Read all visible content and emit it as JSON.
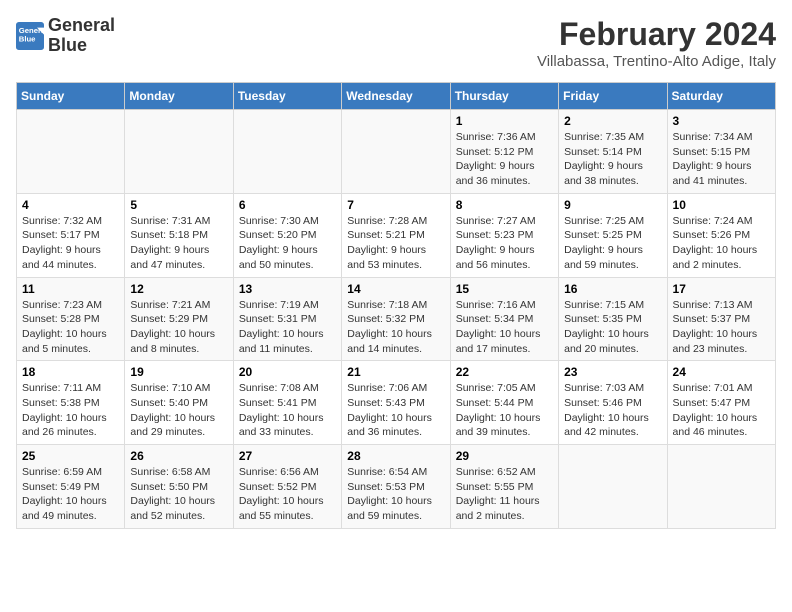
{
  "header": {
    "logo_line1": "General",
    "logo_line2": "Blue",
    "title": "February 2024",
    "subtitle": "Villabassa, Trentino-Alto Adige, Italy"
  },
  "days_of_week": [
    "Sunday",
    "Monday",
    "Tuesday",
    "Wednesday",
    "Thursday",
    "Friday",
    "Saturday"
  ],
  "weeks": [
    [
      {
        "day": "",
        "info": ""
      },
      {
        "day": "",
        "info": ""
      },
      {
        "day": "",
        "info": ""
      },
      {
        "day": "",
        "info": ""
      },
      {
        "day": "1",
        "info": "Sunrise: 7:36 AM\nSunset: 5:12 PM\nDaylight: 9 hours\nand 36 minutes."
      },
      {
        "day": "2",
        "info": "Sunrise: 7:35 AM\nSunset: 5:14 PM\nDaylight: 9 hours\nand 38 minutes."
      },
      {
        "day": "3",
        "info": "Sunrise: 7:34 AM\nSunset: 5:15 PM\nDaylight: 9 hours\nand 41 minutes."
      }
    ],
    [
      {
        "day": "4",
        "info": "Sunrise: 7:32 AM\nSunset: 5:17 PM\nDaylight: 9 hours\nand 44 minutes."
      },
      {
        "day": "5",
        "info": "Sunrise: 7:31 AM\nSunset: 5:18 PM\nDaylight: 9 hours\nand 47 minutes."
      },
      {
        "day": "6",
        "info": "Sunrise: 7:30 AM\nSunset: 5:20 PM\nDaylight: 9 hours\nand 50 minutes."
      },
      {
        "day": "7",
        "info": "Sunrise: 7:28 AM\nSunset: 5:21 PM\nDaylight: 9 hours\nand 53 minutes."
      },
      {
        "day": "8",
        "info": "Sunrise: 7:27 AM\nSunset: 5:23 PM\nDaylight: 9 hours\nand 56 minutes."
      },
      {
        "day": "9",
        "info": "Sunrise: 7:25 AM\nSunset: 5:25 PM\nDaylight: 9 hours\nand 59 minutes."
      },
      {
        "day": "10",
        "info": "Sunrise: 7:24 AM\nSunset: 5:26 PM\nDaylight: 10 hours\nand 2 minutes."
      }
    ],
    [
      {
        "day": "11",
        "info": "Sunrise: 7:23 AM\nSunset: 5:28 PM\nDaylight: 10 hours\nand 5 minutes."
      },
      {
        "day": "12",
        "info": "Sunrise: 7:21 AM\nSunset: 5:29 PM\nDaylight: 10 hours\nand 8 minutes."
      },
      {
        "day": "13",
        "info": "Sunrise: 7:19 AM\nSunset: 5:31 PM\nDaylight: 10 hours\nand 11 minutes."
      },
      {
        "day": "14",
        "info": "Sunrise: 7:18 AM\nSunset: 5:32 PM\nDaylight: 10 hours\nand 14 minutes."
      },
      {
        "day": "15",
        "info": "Sunrise: 7:16 AM\nSunset: 5:34 PM\nDaylight: 10 hours\nand 17 minutes."
      },
      {
        "day": "16",
        "info": "Sunrise: 7:15 AM\nSunset: 5:35 PM\nDaylight: 10 hours\nand 20 minutes."
      },
      {
        "day": "17",
        "info": "Sunrise: 7:13 AM\nSunset: 5:37 PM\nDaylight: 10 hours\nand 23 minutes."
      }
    ],
    [
      {
        "day": "18",
        "info": "Sunrise: 7:11 AM\nSunset: 5:38 PM\nDaylight: 10 hours\nand 26 minutes."
      },
      {
        "day": "19",
        "info": "Sunrise: 7:10 AM\nSunset: 5:40 PM\nDaylight: 10 hours\nand 29 minutes."
      },
      {
        "day": "20",
        "info": "Sunrise: 7:08 AM\nSunset: 5:41 PM\nDaylight: 10 hours\nand 33 minutes."
      },
      {
        "day": "21",
        "info": "Sunrise: 7:06 AM\nSunset: 5:43 PM\nDaylight: 10 hours\nand 36 minutes."
      },
      {
        "day": "22",
        "info": "Sunrise: 7:05 AM\nSunset: 5:44 PM\nDaylight: 10 hours\nand 39 minutes."
      },
      {
        "day": "23",
        "info": "Sunrise: 7:03 AM\nSunset: 5:46 PM\nDaylight: 10 hours\nand 42 minutes."
      },
      {
        "day": "24",
        "info": "Sunrise: 7:01 AM\nSunset: 5:47 PM\nDaylight: 10 hours\nand 46 minutes."
      }
    ],
    [
      {
        "day": "25",
        "info": "Sunrise: 6:59 AM\nSunset: 5:49 PM\nDaylight: 10 hours\nand 49 minutes."
      },
      {
        "day": "26",
        "info": "Sunrise: 6:58 AM\nSunset: 5:50 PM\nDaylight: 10 hours\nand 52 minutes."
      },
      {
        "day": "27",
        "info": "Sunrise: 6:56 AM\nSunset: 5:52 PM\nDaylight: 10 hours\nand 55 minutes."
      },
      {
        "day": "28",
        "info": "Sunrise: 6:54 AM\nSunset: 5:53 PM\nDaylight: 10 hours\nand 59 minutes."
      },
      {
        "day": "29",
        "info": "Sunrise: 6:52 AM\nSunset: 5:55 PM\nDaylight: 11 hours\nand 2 minutes."
      },
      {
        "day": "",
        "info": ""
      },
      {
        "day": "",
        "info": ""
      }
    ]
  ]
}
